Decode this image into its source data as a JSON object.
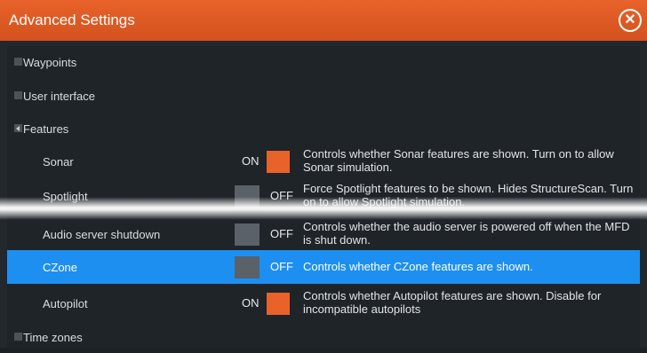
{
  "window": {
    "title": "Advanced Settings"
  },
  "icons": {
    "close": "close-icon"
  },
  "tree": [
    {
      "label": "Waypoints",
      "expanded": false
    },
    {
      "label": "User interface",
      "expanded": false
    },
    {
      "label": "Features",
      "expanded": true
    }
  ],
  "features": [
    {
      "label": "Sonar",
      "state": "ON",
      "description": "Controls whether Sonar features are shown. Turn on to allow Sonar simulation."
    },
    {
      "label": "Spotlight",
      "state": "OFF",
      "description": "Force Spotlight features to be shown. Hides StructureScan. Turn on to allow Spotlight simulation."
    },
    {
      "label": "Audio server shutdown",
      "state": "OFF",
      "description": "Controls whether the audio server is powered off when the MFD is shut down."
    },
    {
      "label": "CZone",
      "state": "OFF",
      "description": "Controls whether CZone features are shown.",
      "selected": true
    },
    {
      "label": "Autopilot",
      "state": "ON",
      "description": "Controls whether Autopilot features are shown. Disable for incompatible autopilots"
    }
  ],
  "tree_after": {
    "label": "Time zones",
    "expanded": false
  },
  "colors": {
    "accent": "#e8622a",
    "selected": "#1d8ff0"
  }
}
